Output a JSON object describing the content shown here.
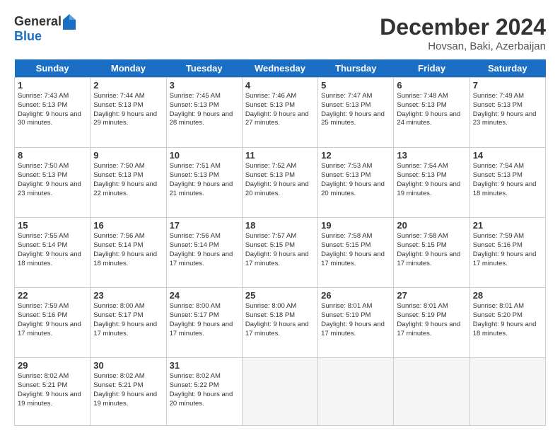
{
  "logo": {
    "general": "General",
    "blue": "Blue"
  },
  "title": {
    "month_year": "December 2024",
    "location": "Hovsan, Baki, Azerbaijan"
  },
  "headers": [
    "Sunday",
    "Monday",
    "Tuesday",
    "Wednesday",
    "Thursday",
    "Friday",
    "Saturday"
  ],
  "weeks": [
    [
      {
        "day": "1",
        "sunrise": "7:43 AM",
        "sunset": "5:13 PM",
        "daylight": "9 hours and 30 minutes."
      },
      {
        "day": "2",
        "sunrise": "7:44 AM",
        "sunset": "5:13 PM",
        "daylight": "9 hours and 29 minutes."
      },
      {
        "day": "3",
        "sunrise": "7:45 AM",
        "sunset": "5:13 PM",
        "daylight": "9 hours and 28 minutes."
      },
      {
        "day": "4",
        "sunrise": "7:46 AM",
        "sunset": "5:13 PM",
        "daylight": "9 hours and 27 minutes."
      },
      {
        "day": "5",
        "sunrise": "7:47 AM",
        "sunset": "5:13 PM",
        "daylight": "9 hours and 25 minutes."
      },
      {
        "day": "6",
        "sunrise": "7:48 AM",
        "sunset": "5:13 PM",
        "daylight": "9 hours and 24 minutes."
      },
      {
        "day": "7",
        "sunrise": "7:49 AM",
        "sunset": "5:13 PM",
        "daylight": "9 hours and 23 minutes."
      }
    ],
    [
      {
        "day": "8",
        "sunrise": "7:50 AM",
        "sunset": "5:13 PM",
        "daylight": "9 hours and 23 minutes."
      },
      {
        "day": "9",
        "sunrise": "7:50 AM",
        "sunset": "5:13 PM",
        "daylight": "9 hours and 22 minutes."
      },
      {
        "day": "10",
        "sunrise": "7:51 AM",
        "sunset": "5:13 PM",
        "daylight": "9 hours and 21 minutes."
      },
      {
        "day": "11",
        "sunrise": "7:52 AM",
        "sunset": "5:13 PM",
        "daylight": "9 hours and 20 minutes."
      },
      {
        "day": "12",
        "sunrise": "7:53 AM",
        "sunset": "5:13 PM",
        "daylight": "9 hours and 20 minutes."
      },
      {
        "day": "13",
        "sunrise": "7:54 AM",
        "sunset": "5:13 PM",
        "daylight": "9 hours and 19 minutes."
      },
      {
        "day": "14",
        "sunrise": "7:54 AM",
        "sunset": "5:13 PM",
        "daylight": "9 hours and 18 minutes."
      }
    ],
    [
      {
        "day": "15",
        "sunrise": "7:55 AM",
        "sunset": "5:14 PM",
        "daylight": "9 hours and 18 minutes."
      },
      {
        "day": "16",
        "sunrise": "7:56 AM",
        "sunset": "5:14 PM",
        "daylight": "9 hours and 18 minutes."
      },
      {
        "day": "17",
        "sunrise": "7:56 AM",
        "sunset": "5:14 PM",
        "daylight": "9 hours and 17 minutes."
      },
      {
        "day": "18",
        "sunrise": "7:57 AM",
        "sunset": "5:15 PM",
        "daylight": "9 hours and 17 minutes."
      },
      {
        "day": "19",
        "sunrise": "7:58 AM",
        "sunset": "5:15 PM",
        "daylight": "9 hours and 17 minutes."
      },
      {
        "day": "20",
        "sunrise": "7:58 AM",
        "sunset": "5:15 PM",
        "daylight": "9 hours and 17 minutes."
      },
      {
        "day": "21",
        "sunrise": "7:59 AM",
        "sunset": "5:16 PM",
        "daylight": "9 hours and 17 minutes."
      }
    ],
    [
      {
        "day": "22",
        "sunrise": "7:59 AM",
        "sunset": "5:16 PM",
        "daylight": "9 hours and 17 minutes."
      },
      {
        "day": "23",
        "sunrise": "8:00 AM",
        "sunset": "5:17 PM",
        "daylight": "9 hours and 17 minutes."
      },
      {
        "day": "24",
        "sunrise": "8:00 AM",
        "sunset": "5:17 PM",
        "daylight": "9 hours and 17 minutes."
      },
      {
        "day": "25",
        "sunrise": "8:00 AM",
        "sunset": "5:18 PM",
        "daylight": "9 hours and 17 minutes."
      },
      {
        "day": "26",
        "sunrise": "8:01 AM",
        "sunset": "5:19 PM",
        "daylight": "9 hours and 17 minutes."
      },
      {
        "day": "27",
        "sunrise": "8:01 AM",
        "sunset": "5:19 PM",
        "daylight": "9 hours and 17 minutes."
      },
      {
        "day": "28",
        "sunrise": "8:01 AM",
        "sunset": "5:20 PM",
        "daylight": "9 hours and 18 minutes."
      }
    ],
    [
      {
        "day": "29",
        "sunrise": "8:02 AM",
        "sunset": "5:21 PM",
        "daylight": "9 hours and 19 minutes."
      },
      {
        "day": "30",
        "sunrise": "8:02 AM",
        "sunset": "5:21 PM",
        "daylight": "9 hours and 19 minutes."
      },
      {
        "day": "31",
        "sunrise": "8:02 AM",
        "sunset": "5:22 PM",
        "daylight": "9 hours and 20 minutes."
      },
      null,
      null,
      null,
      null
    ]
  ],
  "labels": {
    "sunrise": "Sunrise:",
    "sunset": "Sunset:",
    "daylight": "Daylight:"
  }
}
